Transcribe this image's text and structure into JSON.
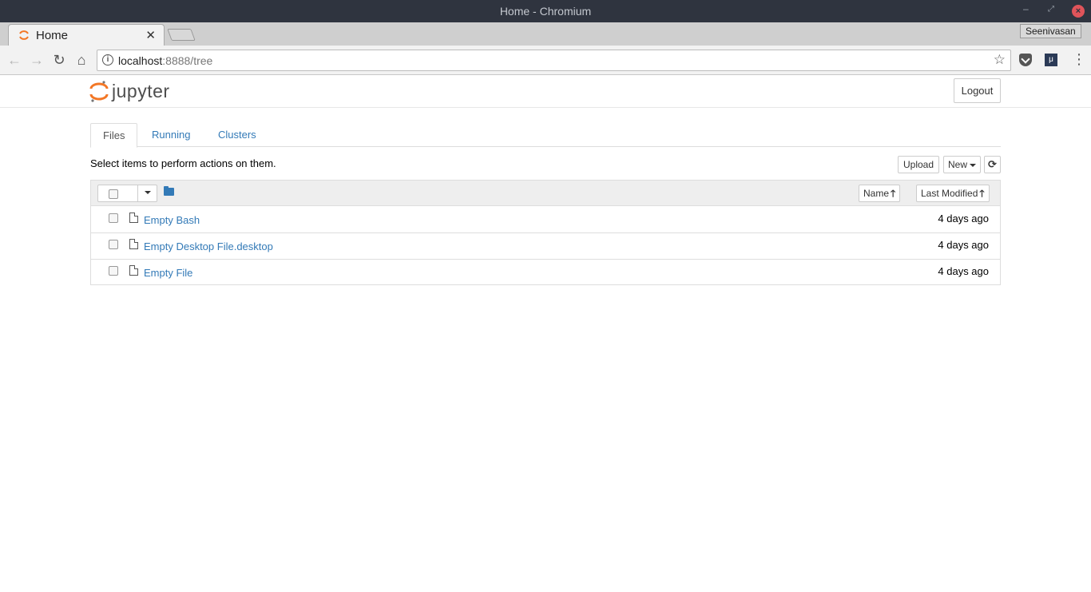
{
  "window": {
    "title": "Home - Chromium"
  },
  "browser": {
    "tab_label": "Home",
    "profile_name": "Seenivasan",
    "url_host": "localhost",
    "url_rest": ":8888/tree"
  },
  "jupyter": {
    "logo_text": "jupyter",
    "logout_label": "Logout",
    "tabs": [
      "Files",
      "Running",
      "Clusters"
    ],
    "hint": "Select items to perform actions on them.",
    "upload_label": "Upload",
    "new_label": "New",
    "sort_name_label": "Name",
    "sort_modified_label": "Last Modified",
    "files": [
      {
        "name": "Empty Bash",
        "modified": "4 days ago"
      },
      {
        "name": "Empty Desktop File.desktop",
        "modified": "4 days ago"
      },
      {
        "name": "Empty File",
        "modified": "4 days ago"
      }
    ]
  },
  "colors": {
    "link": "#337ab7",
    "jupyter_orange": "#f37726",
    "titlebar": "#2f343f"
  }
}
